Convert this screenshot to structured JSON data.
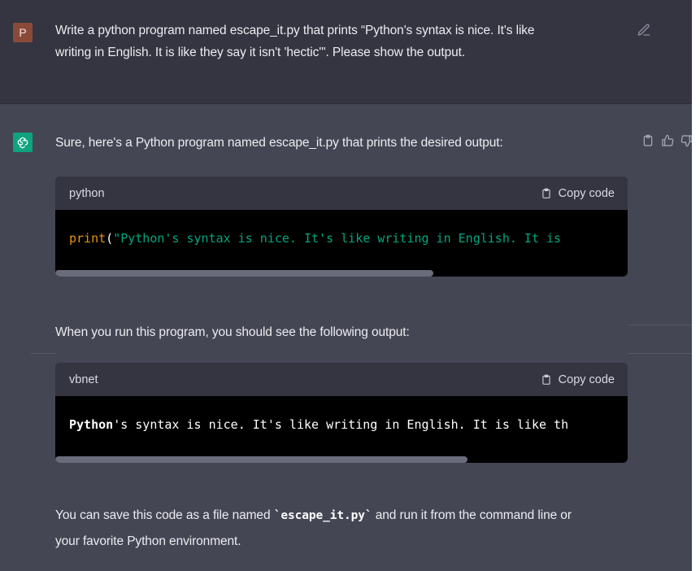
{
  "user_message": {
    "avatar_letter": "P",
    "line1": "Write a python program named escape_it.py  that prints “Python's syntax is nice. It's like",
    "line2": "writing in English. It is like they say it isn't 'hectic'\". Please show the output."
  },
  "assistant": {
    "intro": "Sure, here's a Python program named escape_it.py that prints the desired output:",
    "code_block_1": {
      "language": "python",
      "copy_label": "Copy code",
      "kw": "print",
      "open_paren": "(",
      "string": "\"Python's syntax is nice. It's like writing in English. It is",
      "scroll_fraction": 0.66
    },
    "middle_text": "When you run this program, you should see the following output:",
    "code_block_2": {
      "language": "vbnet",
      "copy_label": "Copy code",
      "bold_word": "Python",
      "rest": "'s syntax is nice. It's like writing in English. It is like th",
      "scroll_fraction": 0.72
    },
    "outro_before": "You can save this code as a file named ",
    "outro_code": "`escape_it.py`",
    "outro_after": " and run it from the command line or",
    "outro_line2": "your favorite Python environment."
  },
  "colors": {
    "user_bg": "#343541",
    "assistant_bg": "#444654",
    "bot_avatar": "#10a37f",
    "user_avatar": "#8a4a3a",
    "keyword": "#e9950c",
    "string": "#00a67d"
  },
  "icons": [
    "edit-icon",
    "openai-logo-icon",
    "clipboard-icon",
    "thumbs-up-icon",
    "thumbs-down-icon"
  ]
}
